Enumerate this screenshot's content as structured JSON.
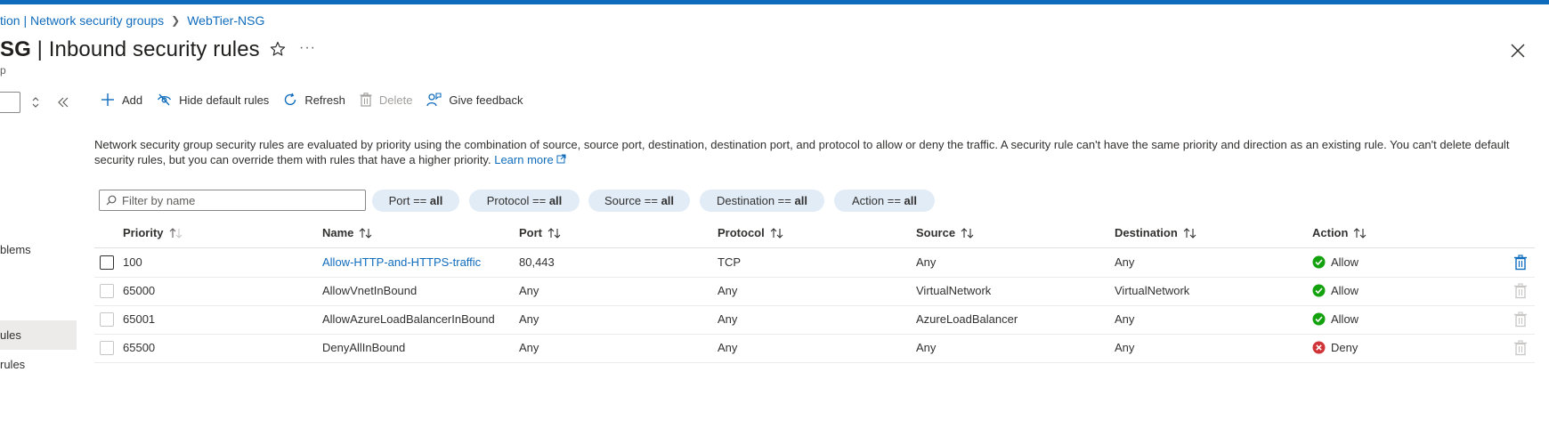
{
  "breadcrumb": {
    "parent": "tion | Network security groups",
    "current": "WebTier-NSG"
  },
  "page": {
    "title_bold": "SG",
    "title_rest": " | Inbound security rules",
    "subtitle": "p",
    "more_label": "···"
  },
  "sidebar": {
    "items": [
      {
        "label": "blems"
      },
      {
        "label": "ules"
      },
      {
        "label": "rules"
      }
    ]
  },
  "toolbar": {
    "add": "Add",
    "hide_default": "Hide default rules",
    "refresh": "Refresh",
    "delete": "Delete",
    "feedback": "Give feedback"
  },
  "description": {
    "text": "Network security group security rules are evaluated by priority using the combination of source, source port, destination, destination port, and protocol to allow or deny the traffic. A security rule can't have the same priority and direction as an existing rule. You can't delete default security rules, but you can override them with rules that have a higher priority.",
    "link": "Learn more"
  },
  "filters": {
    "search_placeholder": "Filter by name",
    "pills": [
      {
        "label": "Port == ",
        "value": "all"
      },
      {
        "label": "Protocol == ",
        "value": "all"
      },
      {
        "label": "Source == ",
        "value": "all"
      },
      {
        "label": "Destination == ",
        "value": "all"
      },
      {
        "label": "Action == ",
        "value": "all"
      }
    ]
  },
  "table": {
    "headers": [
      "Priority",
      "Name",
      "Port",
      "Protocol",
      "Source",
      "Destination",
      "Action"
    ],
    "rows": [
      {
        "priority": "100",
        "name": "Allow-HTTP-and-HTTPS-traffic",
        "port": "80,443",
        "protocol": "TCP",
        "source": "Any",
        "destination": "Any",
        "action": "Allow"
      },
      {
        "priority": "65000",
        "name": "AllowVnetInBound",
        "port": "Any",
        "protocol": "Any",
        "source": "VirtualNetwork",
        "destination": "VirtualNetwork",
        "action": "Allow"
      },
      {
        "priority": "65001",
        "name": "AllowAzureLoadBalancerInBound",
        "port": "Any",
        "protocol": "Any",
        "source": "AzureLoadBalancer",
        "destination": "Any",
        "action": "Allow"
      },
      {
        "priority": "65500",
        "name": "DenyAllInBound",
        "port": "Any",
        "protocol": "Any",
        "source": "Any",
        "destination": "Any",
        "action": "Deny"
      }
    ]
  },
  "colors": {
    "accent": "#0f6cbd",
    "allow": "#13a10e",
    "deny": "#d13438",
    "pill_bg": "#e1ecf7"
  }
}
